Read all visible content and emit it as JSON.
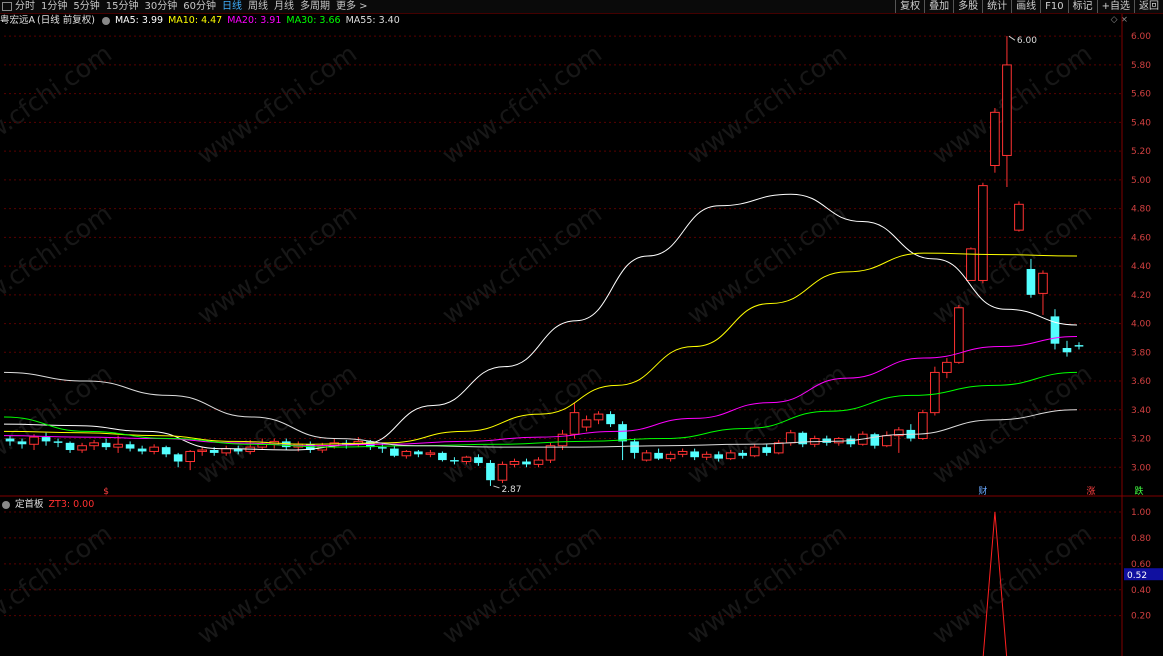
{
  "toolbar": {
    "periods": [
      "分时",
      "1分钟",
      "5分钟",
      "15分钟",
      "30分钟",
      "60分钟",
      "日线",
      "周线",
      "月线",
      "多周期",
      "更多 >"
    ],
    "active_period": "日线",
    "right_buttons": [
      "复权",
      "叠加",
      "多股",
      "统计",
      "画线",
      "F10",
      "标记",
      "+自选",
      "返回"
    ]
  },
  "legend": {
    "stock_name": "粤宏远A",
    "mode": "(日线 前复权)",
    "ma": [
      {
        "label": "MA5: 3.99",
        "color": "#ffffff"
      },
      {
        "label": "MA10: 4.47",
        "color": "#ffff00"
      },
      {
        "label": "MA20: 3.91",
        "color": "#ff00ff"
      },
      {
        "label": "MA30: 3.66",
        "color": "#00ff00"
      },
      {
        "label": "MA55: 3.40",
        "color": "#dddddd"
      }
    ]
  },
  "indicator": {
    "name": "定首板",
    "value_label": "ZT3: 0.00",
    "current_value": "0.52",
    "ticks": [
      "1.00",
      "0.80",
      "0.60",
      "0.40",
      "0.20"
    ]
  },
  "watermark": "www.cfchi.com",
  "chart_data": {
    "type": "candlestick",
    "price_ticks": [
      "6.00",
      "5.80",
      "5.60",
      "5.40",
      "5.20",
      "5.00",
      "4.80",
      "4.60",
      "4.40",
      "4.20",
      "4.00",
      "3.80",
      "3.60",
      "3.40",
      "3.20",
      "3.00"
    ],
    "ylim": [
      2.8,
      6.05
    ],
    "annotations": [
      {
        "text": "6.00",
        "value": 6.0
      },
      {
        "text": "2.87",
        "value": 2.87
      }
    ],
    "markers": [
      {
        "text": "$",
        "color": "#ff4040"
      },
      {
        "text": "财",
        "color": "#6aa8ff"
      },
      {
        "text": "涨",
        "color": "#ff4040"
      },
      {
        "text": "跌",
        "color": "#40ff40"
      }
    ],
    "candles": [
      [
        3.2,
        3.18,
        3.22,
        3.15
      ],
      [
        3.18,
        3.16,
        3.2,
        3.13
      ],
      [
        3.16,
        3.21,
        3.23,
        3.12
      ],
      [
        3.21,
        3.18,
        3.24,
        3.15
      ],
      [
        3.18,
        3.17,
        3.2,
        3.14
      ],
      [
        3.17,
        3.12,
        3.18,
        3.1
      ],
      [
        3.12,
        3.15,
        3.17,
        3.1
      ],
      [
        3.15,
        3.17,
        3.19,
        3.12
      ],
      [
        3.17,
        3.14,
        3.2,
        3.12
      ],
      [
        3.14,
        3.16,
        3.22,
        3.1
      ],
      [
        3.16,
        3.13,
        3.18,
        3.11
      ],
      [
        3.13,
        3.11,
        3.15,
        3.09
      ],
      [
        3.11,
        3.14,
        3.16,
        3.09
      ],
      [
        3.14,
        3.09,
        3.15,
        3.07
      ],
      [
        3.09,
        3.04,
        3.1,
        3.0
      ],
      [
        3.04,
        3.11,
        3.12,
        2.98
      ],
      [
        3.11,
        3.12,
        3.14,
        3.08
      ],
      [
        3.12,
        3.1,
        3.14,
        3.08
      ],
      [
        3.1,
        3.13,
        3.15,
        3.08
      ],
      [
        3.13,
        3.11,
        3.15,
        3.09
      ],
      [
        3.11,
        3.14,
        3.19,
        3.09
      ],
      [
        3.14,
        3.16,
        3.2,
        3.12
      ],
      [
        3.16,
        3.18,
        3.2,
        3.13
      ],
      [
        3.18,
        3.14,
        3.2,
        3.12
      ],
      [
        3.14,
        3.16,
        3.18,
        3.11
      ],
      [
        3.16,
        3.12,
        3.18,
        3.1
      ],
      [
        3.12,
        3.15,
        3.17,
        3.1
      ],
      [
        3.15,
        3.17,
        3.2,
        3.13
      ],
      [
        3.17,
        3.16,
        3.19,
        3.13
      ],
      [
        3.16,
        3.18,
        3.21,
        3.14
      ],
      [
        3.18,
        3.14,
        3.19,
        3.12
      ],
      [
        3.14,
        3.13,
        3.17,
        3.1
      ],
      [
        3.13,
        3.08,
        3.15,
        3.07
      ],
      [
        3.08,
        3.11,
        3.12,
        3.06
      ],
      [
        3.11,
        3.09,
        3.12,
        3.07
      ],
      [
        3.09,
        3.1,
        3.12,
        3.07
      ],
      [
        3.1,
        3.05,
        3.11,
        3.04
      ],
      [
        3.05,
        3.04,
        3.07,
        3.02
      ],
      [
        3.04,
        3.07,
        3.08,
        3.02
      ],
      [
        3.07,
        3.03,
        3.09,
        3.01
      ],
      [
        3.03,
        2.91,
        3.05,
        2.87
      ],
      [
        2.91,
        3.02,
        3.04,
        2.89
      ],
      [
        3.02,
        3.04,
        3.06,
        3.0
      ],
      [
        3.04,
        3.02,
        3.06,
        3.0
      ],
      [
        3.02,
        3.05,
        3.07,
        3.0
      ],
      [
        3.05,
        3.15,
        3.17,
        3.03
      ],
      [
        3.15,
        3.23,
        3.26,
        3.12
      ],
      [
        3.23,
        3.38,
        3.45,
        3.2
      ],
      [
        3.28,
        3.33,
        3.36,
        3.25
      ],
      [
        3.33,
        3.37,
        3.39,
        3.3
      ],
      [
        3.37,
        3.3,
        3.39,
        3.28
      ],
      [
        3.3,
        3.18,
        3.32,
        3.05
      ],
      [
        3.18,
        3.1,
        3.2,
        3.06
      ],
      [
        3.05,
        3.1,
        3.12,
        3.04
      ],
      [
        3.1,
        3.06,
        3.13,
        3.05
      ],
      [
        3.06,
        3.09,
        3.11,
        3.04
      ],
      [
        3.09,
        3.11,
        3.13,
        3.07
      ],
      [
        3.11,
        3.07,
        3.13,
        3.05
      ],
      [
        3.07,
        3.09,
        3.11,
        3.05
      ],
      [
        3.09,
        3.06,
        3.11,
        3.04
      ],
      [
        3.06,
        3.1,
        3.12,
        3.05
      ],
      [
        3.1,
        3.08,
        3.12,
        3.06
      ],
      [
        3.08,
        3.14,
        3.16,
        3.07
      ],
      [
        3.14,
        3.1,
        3.16,
        3.08
      ],
      [
        3.1,
        3.17,
        3.19,
        3.09
      ],
      [
        3.17,
        3.24,
        3.26,
        3.15
      ],
      [
        3.24,
        3.16,
        3.25,
        3.14
      ],
      [
        3.16,
        3.2,
        3.22,
        3.14
      ],
      [
        3.2,
        3.17,
        3.22,
        3.15
      ],
      [
        3.17,
        3.2,
        3.21,
        3.15
      ],
      [
        3.2,
        3.16,
        3.22,
        3.14
      ],
      [
        3.16,
        3.23,
        3.25,
        3.15
      ],
      [
        3.23,
        3.15,
        3.24,
        3.13
      ],
      [
        3.15,
        3.22,
        3.25,
        3.14
      ],
      [
        3.22,
        3.26,
        3.28,
        3.1
      ],
      [
        3.26,
        3.2,
        3.3,
        3.18
      ],
      [
        3.2,
        3.38,
        3.4,
        3.19
      ],
      [
        3.38,
        3.66,
        3.7,
        3.36
      ],
      [
        3.66,
        3.73,
        3.76,
        3.62
      ],
      [
        3.73,
        4.11,
        4.13,
        3.72
      ],
      [
        4.3,
        4.52,
        4.53,
        4.3
      ],
      [
        4.3,
        4.96,
        4.98,
        4.28
      ],
      [
        5.1,
        5.47,
        5.5,
        5.05
      ],
      [
        5.17,
        5.8,
        6.0,
        4.95
      ],
      [
        4.65,
        4.83,
        4.85,
        4.64
      ],
      [
        4.38,
        4.2,
        4.45,
        4.18
      ],
      [
        4.21,
        4.35,
        4.37,
        4.06
      ],
      [
        4.05,
        3.86,
        4.1,
        3.82
      ],
      [
        3.83,
        3.8,
        3.88,
        3.77
      ],
      [
        3.85,
        3.84,
        3.87,
        3.82
      ]
    ],
    "series": [
      {
        "name": "MA5",
        "color": "#ffffff",
        "values": [
          3.3,
          3.29,
          3.25,
          3.13,
          3.12,
          3.16,
          3.43,
          3.7,
          4.02,
          4.47,
          4.82,
          4.9,
          4.71,
          4.45,
          4.1,
          3.99
        ]
      },
      {
        "name": "MA10",
        "color": "#ffff00",
        "values": [
          3.25,
          3.24,
          3.22,
          3.18,
          3.16,
          3.17,
          3.25,
          3.37,
          3.57,
          3.84,
          4.14,
          4.36,
          4.49,
          4.48,
          4.47
        ]
      },
      {
        "name": "MA20",
        "color": "#ff00ff",
        "values": [
          3.22,
          3.21,
          3.2,
          3.17,
          3.15,
          3.16,
          3.18,
          3.21,
          3.25,
          3.34,
          3.45,
          3.62,
          3.76,
          3.84,
          3.91
        ]
      },
      {
        "name": "MA30",
        "color": "#00ff00",
        "values": [
          3.35,
          3.25,
          3.2,
          3.16,
          3.14,
          3.15,
          3.16,
          3.18,
          3.2,
          3.27,
          3.39,
          3.5,
          3.57,
          3.66
        ]
      },
      {
        "name": "MA55",
        "color": "#dddddd",
        "values": [
          3.66,
          3.6,
          3.5,
          3.35,
          3.2,
          3.15,
          3.14,
          3.14,
          3.15,
          3.16,
          3.18,
          3.23,
          3.33,
          3.4
        ]
      }
    ],
    "zt3": [
      0,
      0,
      0,
      0,
      0,
      0,
      0,
      0,
      0,
      0,
      0,
      0,
      0,
      0,
      0,
      0,
      0,
      0,
      0,
      0,
      0,
      0,
      0,
      0,
      0,
      0,
      0,
      0,
      0,
      0,
      0,
      0,
      0,
      0,
      0,
      0,
      0,
      0,
      0,
      0,
      0,
      0,
      0,
      0,
      0,
      0,
      0,
      0,
      0,
      0,
      0,
      0,
      0,
      0,
      0,
      0,
      0,
      0,
      0,
      0,
      0,
      0,
      0,
      0,
      0,
      0,
      0,
      0,
      0,
      0,
      0,
      0,
      0,
      0,
      0,
      0,
      0,
      0,
      0,
      0,
      0,
      0,
      1,
      0,
      0,
      0,
      0,
      0,
      0,
      0
    ]
  }
}
